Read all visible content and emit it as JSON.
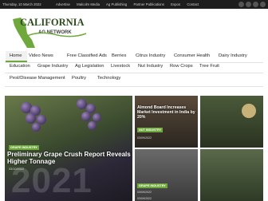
{
  "topbar": {
    "date": "Thursday, 10 March 2022",
    "links": [
      "Advertise",
      "Malcolm Media",
      "Ag Publishing",
      "Partner Publications",
      "Expos",
      "Contact"
    ]
  },
  "logo": {
    "line1": "CALIFORNIA",
    "line2": "AG NETWORK"
  },
  "nav": {
    "row1": [
      "Home",
      "Video News",
      "Free Classified Ads",
      "Berries",
      "Citrus Industry",
      "Consumer Health",
      "Dairy Industry"
    ],
    "row2": [
      "Education",
      "Grape Industry",
      "Ag Legislation",
      "Livestock",
      "Nut Industry",
      "Row Crops",
      "Tree Fruit"
    ],
    "row3": [
      "Pest/Disease Management",
      "Poultry",
      "Technology"
    ]
  },
  "hero": {
    "tag": "GRAPE INDUSTRY",
    "title": "Preliminary Grape Crush Report Reveals Higher Tonnage",
    "date": "03/10/2022",
    "year": "2021"
  },
  "cards": [
    {
      "tag": "",
      "title": "Almond Board Increases Market Investment in India by 20%",
      "date": "03/09/2022"
    },
    {
      "tag": "",
      "title": "",
      "date": ""
    },
    {
      "tag": "NUT INDUSTRY",
      "title": "",
      "date": ""
    },
    {
      "tag": "",
      "title": "",
      "date": "03/09/2022"
    },
    {
      "tag": "GRAPE INDUSTRY",
      "title": "",
      "date": "03/09/2022"
    },
    {
      "tag": "",
      "title": "",
      "date": ""
    }
  ],
  "colors": {
    "accent": "#6fa83d",
    "topbar": "#1e1e1e"
  }
}
